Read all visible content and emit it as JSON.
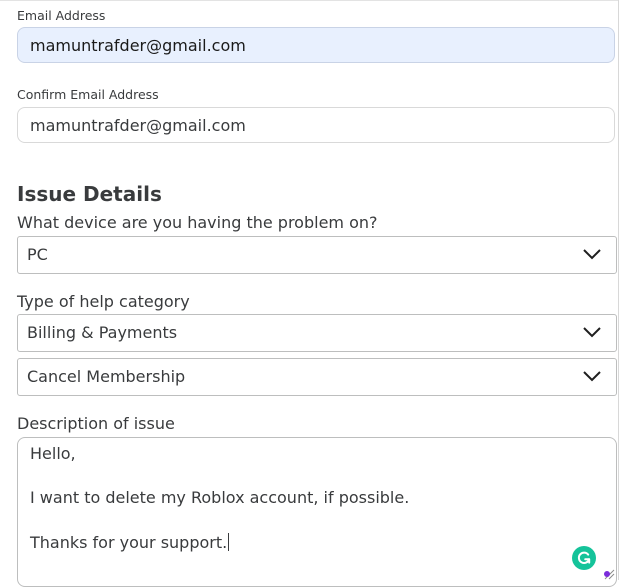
{
  "form": {
    "email": {
      "label": "Email Address",
      "value": "mamuntrafder@gmail.com"
    },
    "confirm_email": {
      "label": "Confirm Email Address",
      "value": "mamuntrafder@gmail.com"
    },
    "issue_details": {
      "title": "Issue Details",
      "device": {
        "label": "What device are you having the problem on?",
        "selected": "PC"
      },
      "help_category": {
        "label": "Type of help category",
        "selected": "Billing & Payments",
        "subcategory_selected": "Cancel Membership"
      },
      "description": {
        "label": "Description of issue",
        "lines": [
          "Hello,",
          "I want to delete my Roblox account, if possible.",
          "Thanks for your support."
        ]
      }
    }
  },
  "icons": {
    "dropdown": "chevron-down-icon",
    "grammarly": "grammarly-icon",
    "resize": "resize-handle-icon"
  },
  "colors": {
    "autofill_background": "#e8f0fe",
    "text": "#393b3d",
    "grammarly_green": "#15c39a",
    "indicator_purple": "#7b2ddb"
  }
}
